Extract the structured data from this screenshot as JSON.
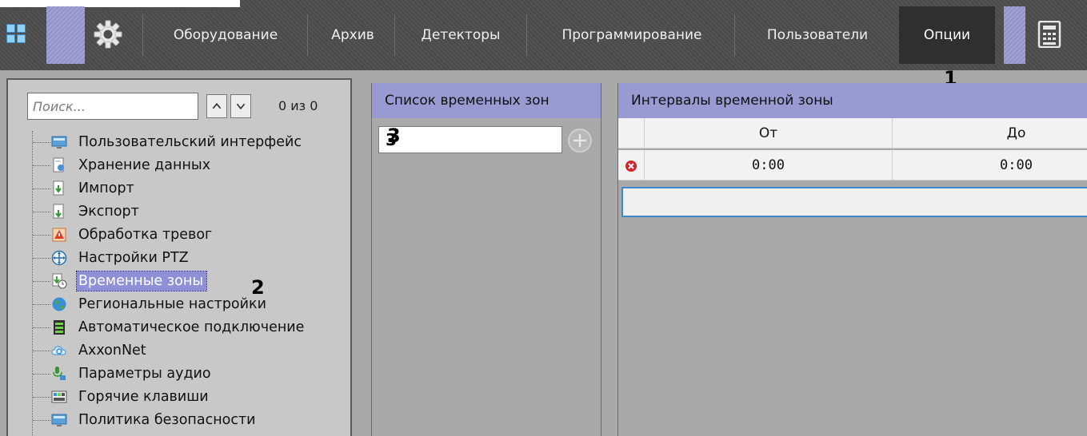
{
  "topbar": {
    "tabs": [
      {
        "label": "Оборудование"
      },
      {
        "label": "Архив"
      },
      {
        "label": "Детекторы"
      },
      {
        "label": "Программирование"
      },
      {
        "label": "Пользователи"
      },
      {
        "label": "Опции",
        "active": true
      }
    ],
    "icons": [
      "grid-icon",
      "gear-icon",
      "calculator-icon"
    ],
    "accent_color": "#9a9ad2",
    "active_tab_color": "#2f2f2f"
  },
  "search": {
    "placeholder": "Поиск...",
    "count": "0 из 0"
  },
  "tree": {
    "items": [
      {
        "label": "Пользовательский интерфейс",
        "icon": "monitor-icon"
      },
      {
        "label": "Хранение данных",
        "icon": "storage-icon"
      },
      {
        "label": "Импорт",
        "icon": "import-icon"
      },
      {
        "label": "Экспорт",
        "icon": "export-icon"
      },
      {
        "label": "Обработка тревог",
        "icon": "alarm-icon"
      },
      {
        "label": "Настройки PTZ",
        "icon": "ptz-icon"
      },
      {
        "label": "Временные зоны",
        "icon": "time-zones-icon",
        "selected": true
      },
      {
        "label": "Региональные настройки",
        "icon": "globe-icon"
      },
      {
        "label": "Автоматическое подключение",
        "icon": "auto-connect-icon"
      },
      {
        "label": "AxxonNet",
        "icon": "cloud-icon"
      },
      {
        "label": "Параметры аудио",
        "icon": "audio-icon"
      },
      {
        "label": "Горячие клавиши",
        "icon": "hotkeys-icon"
      },
      {
        "label": "Политика безопасности",
        "icon": "security-policy-icon"
      }
    ]
  },
  "callouts": {
    "one": "1",
    "two": "2",
    "three": "3"
  },
  "time_zones": {
    "header": "Список временных зон",
    "input_value": "3"
  },
  "intervals": {
    "header": "Интервалы временной зоны",
    "columns": [
      "От",
      "До"
    ],
    "rows": [
      {
        "from": "0:00",
        "to": "0:00"
      }
    ],
    "new_row_border_color": "#3c88d0"
  }
}
